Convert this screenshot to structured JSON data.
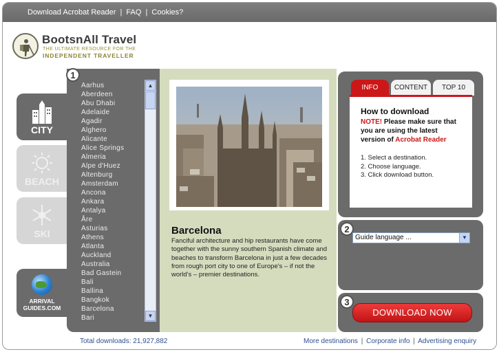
{
  "topbar": {
    "download_acrobat": "Download Acrobat Reader",
    "faq": "FAQ",
    "cookies": "Cookies?",
    "separator": "|"
  },
  "logo": {
    "name": "BootsnAll Travel",
    "tagline1": "THE ULTIMATE RESOURCE FOR THE",
    "tagline2": "INDEPENDENT TRAVELLER"
  },
  "categories": [
    {
      "label": "CITY",
      "icon": "city-icon",
      "active": true
    },
    {
      "label": "BEACH",
      "icon": "sun-icon",
      "active": false
    },
    {
      "label": "SKI",
      "icon": "snowflake-icon",
      "active": false
    }
  ],
  "arrival": {
    "line1": "ARRIVAL",
    "line2": "GUIDES.COM",
    "icon": "globe-icon"
  },
  "steps": {
    "one": "1",
    "two": "2",
    "three": "3"
  },
  "destinations": [
    "Aarhus",
    "Aberdeen",
    "Abu Dhabi",
    "Adelaide",
    "Agadir",
    "Alghero",
    "Alicante",
    "Alice Springs",
    "Almeria",
    "Alpe d'Huez",
    "Altenburg",
    "Amsterdam",
    "Ancona",
    "Ankara",
    "Antalya",
    "Åre",
    "Asturias",
    "Athens",
    "Atlanta",
    "Auckland",
    "Australia",
    "Bad Gastein",
    "Bali",
    "Ballina",
    "Bangkok",
    "Barcelona",
    "Bari"
  ],
  "selected_city": {
    "title": "Barcelona",
    "description": "Fanciful architecture and hip restaurants have come together with the sunny southern Spanish climate and beaches to transform Barcelona in just a few decades from rough port city to one of Europe's – if not the world's – premier destinations."
  },
  "info_tabs": [
    "INFO",
    "CONTENT",
    "TOP 10"
  ],
  "info": {
    "heading": "How to download",
    "note_label": "NOTE!",
    "note_text": "Please make sure that you are using the latest version of",
    "note_link": "Acrobat Reader",
    "steps": [
      "1. Select a destination.",
      "2. Choose language.",
      "3. Click download button."
    ]
  },
  "language_select": {
    "value": "Guide language ..."
  },
  "download_button": "DOWNLOAD NOW",
  "footer": {
    "total_downloads": "Total downloads: 21,927,882",
    "more_destinations": "More destinations",
    "corporate_info": "Corporate info",
    "advertising_enquiry": "Advertising enquiry",
    "separator": "|"
  },
  "colors": {
    "accent_red": "#cc1719",
    "panel_gray": "#6b6b6b",
    "panel_green": "#d5dcbe",
    "link_blue": "#2e4f8f"
  }
}
